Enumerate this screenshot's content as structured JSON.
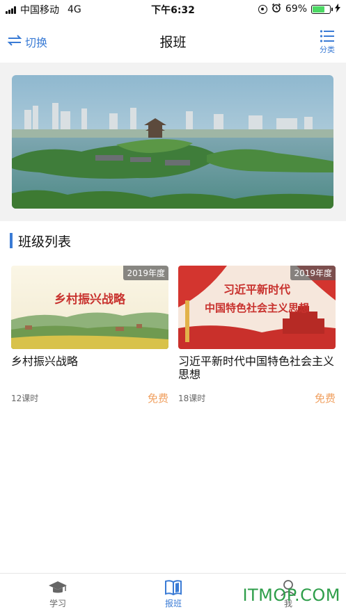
{
  "status_bar": {
    "carrier": "中国移动",
    "network": "4G",
    "time": "下午6:32",
    "battery": "69%",
    "battery_level": 0.69
  },
  "nav": {
    "switch_label": "切换",
    "title": "报班",
    "category_label": "分类"
  },
  "section": {
    "title": "班级列表"
  },
  "courses": [
    {
      "year": "2019年度",
      "banner_text": "乡村振兴战略",
      "title": "乡村振兴战略",
      "hours": "12课时",
      "price": "免费"
    },
    {
      "year": "2019年度",
      "banner_line1": "习近平新时代",
      "banner_line2": "中国特色社会主义思想",
      "title": "习近平新时代中国特色社会主义思想",
      "hours": "18课时",
      "price": "免费"
    }
  ],
  "tabs": [
    {
      "label": "学习",
      "icon": "graduation-cap-icon"
    },
    {
      "label": "报班",
      "icon": "book-icon",
      "active": true
    },
    {
      "label": "我",
      "icon": "person-icon"
    }
  ],
  "watermark": "ITMOP.COM",
  "colors": {
    "accent": "#3a7bd5",
    "price": "#f0a060",
    "battery": "#4cd964"
  }
}
